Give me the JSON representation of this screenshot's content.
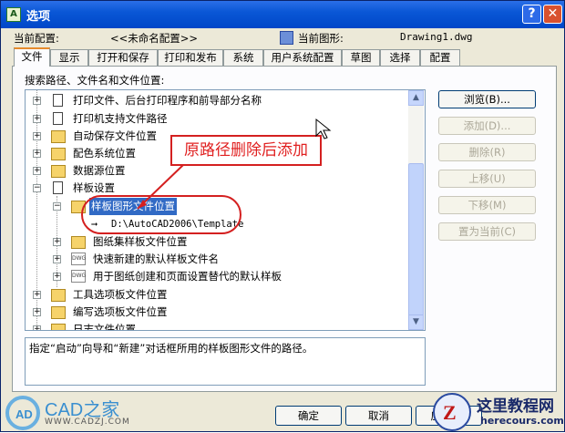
{
  "window": {
    "title": "选项",
    "help_glyph": "?",
    "close_glyph": "✕"
  },
  "profile": {
    "current_profile_label": "当前配置:",
    "current_profile_value": "<<未命名配置>>",
    "current_drawing_label": "当前图形:",
    "current_drawing_value": "Drawing1.dwg"
  },
  "tabs": [
    "文件",
    "显示",
    "打开和保存",
    "打印和发布",
    "系统",
    "用户系统配置",
    "草图",
    "选择",
    "配置"
  ],
  "tree": {
    "heading": "搜索路径、文件名和文件位置:",
    "items": [
      {
        "label": "打印文件、后台打印程序和前导部分名称",
        "icon": "document-icon"
      },
      {
        "label": "打印机支持文件路径",
        "icon": "document-icon"
      },
      {
        "label": "自动保存文件位置",
        "icon": "folder-icon"
      },
      {
        "label": "配色系统位置",
        "icon": "folder-icon"
      },
      {
        "label": "数据源位置",
        "icon": "folder-icon"
      },
      {
        "label": "样板设置",
        "icon": "document-icon"
      },
      {
        "label": "样板图形文件位置",
        "icon": "folder-icon"
      },
      {
        "label": "D:\\AutoCAD2006\\Template",
        "icon": "arrow-icon"
      },
      {
        "label": "图纸集样板文件位置",
        "icon": "folder-icon"
      },
      {
        "label": "快速新建的默认样板文件名",
        "icon": "dwg-icon"
      },
      {
        "label": "用于图纸创建和页面设置替代的默认样板",
        "icon": "dwg-icon"
      },
      {
        "label": "工具选项板文件位置",
        "icon": "folder-icon"
      },
      {
        "label": "编写选项板文件位置",
        "icon": "folder-icon"
      },
      {
        "label": "日志文件位置",
        "icon": "folder-icon"
      }
    ]
  },
  "description": "指定“启动”向导和“新建”对话框所用的样板图形文件的路径。",
  "side_buttons": [
    {
      "label": "浏览(B)...",
      "enabled": true
    },
    {
      "label": "添加(D)...",
      "enabled": false
    },
    {
      "label": "删除(R)",
      "enabled": false
    },
    {
      "label": "上移(U)",
      "enabled": false
    },
    {
      "label": "下移(M)",
      "enabled": false
    },
    {
      "label": "置为当前(C)",
      "enabled": false
    }
  ],
  "footer": {
    "ok": "确定",
    "cancel": "取消",
    "apply": "应用(A)"
  },
  "annotation": {
    "callout_text": "原路径删除后添加"
  },
  "watermarks": {
    "left_brand": "CAD之家",
    "left_url": "WWW.CADZJ.COM",
    "right_brand": "这里教程网",
    "right_url": "herecours.com"
  },
  "colors": {
    "title_bar": "#0a57d6",
    "selection": "#316ac5",
    "annotation_red": "#d42020",
    "tab_highlight": "#e68b2c"
  }
}
